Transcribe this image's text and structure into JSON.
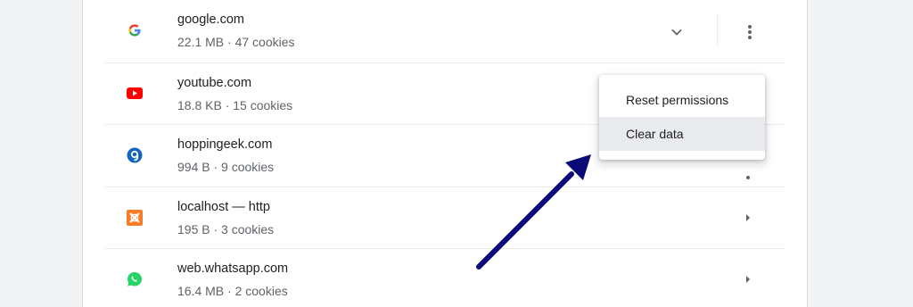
{
  "sites": [
    {
      "name": "google.com",
      "meta": "22.1 MB · 47 cookies",
      "icon": "google-icon",
      "control": "expand"
    },
    {
      "name": "youtube.com",
      "meta": "18.8 KB · 15 cookies",
      "icon": "youtube-icon",
      "control": "none"
    },
    {
      "name": "hoppingeek.com",
      "meta": "994 B · 9 cookies",
      "icon": "hoppingeek-icon",
      "control": "partial"
    },
    {
      "name": "localhost — http",
      "meta": "195 B · 3 cookies",
      "icon": "xampp-icon",
      "control": "arrow"
    },
    {
      "name": "web.whatsapp.com",
      "meta": "16.4 MB · 2 cookies",
      "icon": "whatsapp-icon",
      "control": "arrow"
    }
  ],
  "menu": {
    "reset_label": "Reset permissions",
    "clear_label": "Clear data"
  },
  "colors": {
    "annotation_arrow": "#0a0a78",
    "menu_hover": "#e8eaed",
    "youtube_red": "#ff0000",
    "whatsapp_green": "#25d366",
    "hoppingeek_blue": "#1565c0",
    "xampp_orange": "#fb7a24"
  }
}
